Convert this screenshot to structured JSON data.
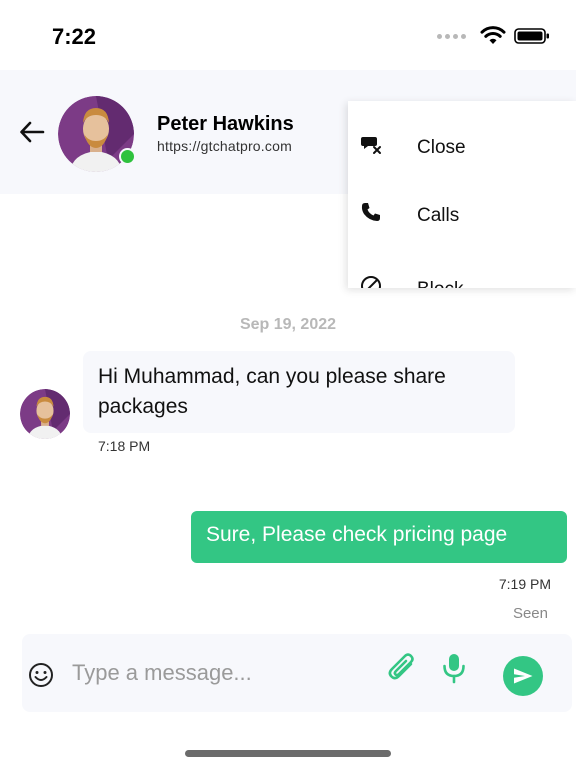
{
  "status_bar": {
    "time": "7:22"
  },
  "header": {
    "contact_name": "Peter Hawkins",
    "contact_subtitle": "https://gtchatpro.com",
    "online": true,
    "icons": {
      "back": "arrow-left-icon"
    }
  },
  "menu": {
    "items": [
      {
        "label": "Close",
        "icon": "chat-close-icon"
      },
      {
        "label": "Calls",
        "icon": "phone-icon"
      },
      {
        "label": "Block",
        "icon": "block-icon"
      }
    ]
  },
  "conversation": {
    "date_divider": "Sep 19, 2022",
    "messages": [
      {
        "direction": "incoming",
        "text": "Hi Muhammad, can you please share packages",
        "time": "7:18 PM"
      },
      {
        "direction": "outgoing",
        "text": "Sure, Please check pricing page",
        "time": "7:19 PM",
        "status": "Seen"
      }
    ]
  },
  "composer": {
    "placeholder": "Type a message...",
    "value": "",
    "icons": [
      "emoji-icon",
      "attachment-icon",
      "microphone-icon",
      "send-icon"
    ]
  },
  "colors": {
    "accent": "#33c684",
    "online": "#2fc23e",
    "header_bg": "#f7f8fc",
    "bubble_in_bg": "#f7f8fc",
    "avatar_bg": "#7c3b86"
  }
}
